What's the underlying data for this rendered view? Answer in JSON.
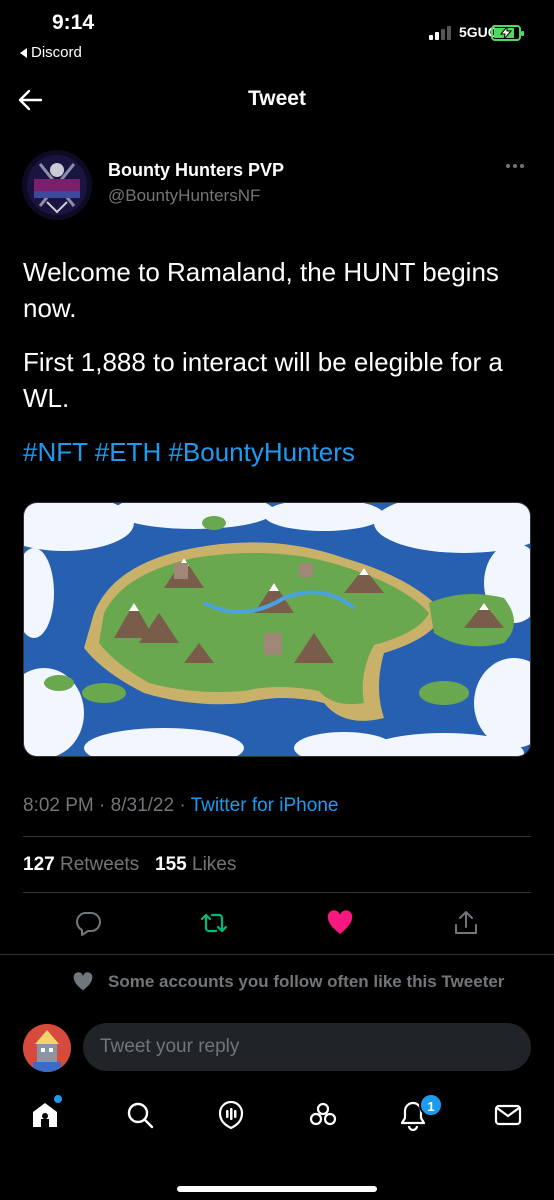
{
  "status_bar": {
    "time": "9:14",
    "back_app": "Discord",
    "network": "5GUC"
  },
  "header": {
    "title": "Tweet"
  },
  "tweet": {
    "author_name": "Bounty Hunters PVP",
    "author_handle": "@BountyHuntersNF",
    "paragraph_1": "Welcome to Ramaland, the HUNT begins now.",
    "paragraph_2": "First 1,888 to interact will be elegible for a WL.",
    "hashtags": "#NFT #ETH #BountyHunters",
    "time": "8:02 PM",
    "date": "8/31/22",
    "source": "Twitter for iPhone",
    "retweet_count": "127",
    "retweet_label": "Retweets",
    "like_count": "155",
    "like_label": "Likes"
  },
  "social_context": "Some accounts you follow often like this Tweeter",
  "reply": {
    "placeholder": "Tweet your reply"
  },
  "bottom_nav": {
    "notification_badge": "1",
    "items": [
      "home-icon",
      "search-icon",
      "spaces-icon",
      "communities-icon",
      "notifications-icon",
      "messages-icon"
    ]
  },
  "colors": {
    "accent": "#1d9bf0",
    "like": "#f91880",
    "retweet": "#00ba7c",
    "muted": "#71767b",
    "background": "#000000"
  }
}
